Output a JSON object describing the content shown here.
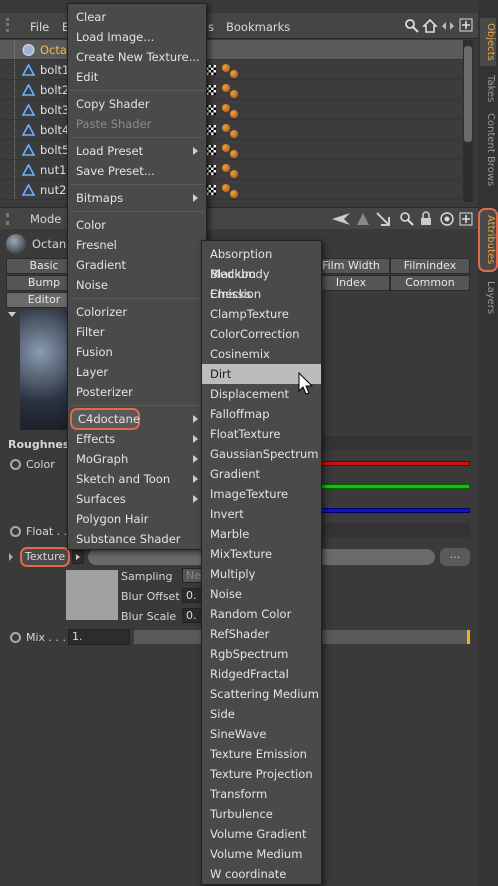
{
  "menubar": {
    "items": [
      "File",
      "E",
      "s",
      "Bookmarks"
    ]
  },
  "objects": [
    {
      "name": "Octan"
    },
    {
      "name": "bolt1"
    },
    {
      "name": "bolt2"
    },
    {
      "name": "bolt3"
    },
    {
      "name": "bolt4"
    },
    {
      "name": "bolt5"
    },
    {
      "name": "nut1"
    },
    {
      "name": "nut2"
    }
  ],
  "side_tabs": [
    "Objects",
    "Takes",
    "Content Brows",
    "Attributes",
    "Layers"
  ],
  "attr": {
    "mode": "Mode",
    "title": "Octane",
    "tabs_row1": [
      "Basic",
      "Film Width",
      "Filmindex"
    ],
    "tabs_row2": [
      "Bump",
      "Index",
      "Common"
    ],
    "tabs_row3": [
      "Editor"
    ],
    "roughness": "Roughness",
    "color": "Color",
    "float": "Float . .",
    "texture": "Texture",
    "sampling": "Sampling",
    "sampling_val": "Ne",
    "blur_offset": "Blur Offset",
    "blur_offset_val": "0.",
    "blur_scale": "Blur Scale",
    "blur_scale_val": "0.",
    "mix": "Mix . . .",
    "mix_val": "1.",
    "browse": "..."
  },
  "colors": {
    "accent": "#e06a4a",
    "red": "#d01010",
    "green": "#10c010",
    "blue": "#1010d0",
    "highlight": "#f0c040"
  },
  "main_menu": [
    {
      "label": "Clear"
    },
    {
      "label": "Load Image..."
    },
    {
      "label": "Create New Texture..."
    },
    {
      "label": "Edit"
    },
    {
      "sep": true
    },
    {
      "label": "Copy Shader"
    },
    {
      "label": "Paste Shader",
      "disabled": true
    },
    {
      "sep": true
    },
    {
      "label": "Load Preset",
      "sub": true
    },
    {
      "label": "Save Preset..."
    },
    {
      "sep": true
    },
    {
      "label": "Bitmaps",
      "sub": true
    },
    {
      "sep": true
    },
    {
      "label": "Color"
    },
    {
      "label": "Fresnel"
    },
    {
      "label": "Gradient"
    },
    {
      "label": "Noise"
    },
    {
      "sep": true
    },
    {
      "label": "Colorizer"
    },
    {
      "label": "Filter"
    },
    {
      "label": "Fusion"
    },
    {
      "label": "Layer"
    },
    {
      "label": "Posterizer"
    },
    {
      "sep": true
    },
    {
      "label": "C4doctane",
      "sub": true,
      "active": true
    },
    {
      "label": "Effects",
      "sub": true
    },
    {
      "label": "MoGraph",
      "sub": true
    },
    {
      "label": "Sketch and Toon",
      "sub": true
    },
    {
      "label": "Surfaces",
      "sub": true
    },
    {
      "label": "Polygon Hair"
    },
    {
      "label": "Substance Shader"
    }
  ],
  "sub_menu": [
    "Absorption Medium",
    "Blackbody Emission",
    "Checks",
    "ClampTexture",
    "ColorCorrection",
    "Cosinemix",
    "Dirt",
    "Displacement",
    "Falloffmap",
    "FloatTexture",
    "GaussianSpectrum",
    "Gradient",
    "ImageTexture",
    "Invert",
    "Marble",
    "MixTexture",
    "Multiply",
    "Noise",
    "Random Color",
    "RefShader",
    "RgbSpectrum",
    "RidgedFractal",
    "Scattering Medium",
    "Side",
    "SineWave",
    "Texture Emission",
    "Texture Projection",
    "Transform",
    "Turbulence",
    "Volume Gradient",
    "Volume Medium",
    "W coordinate"
  ],
  "sub_menu_hover": "Dirt"
}
